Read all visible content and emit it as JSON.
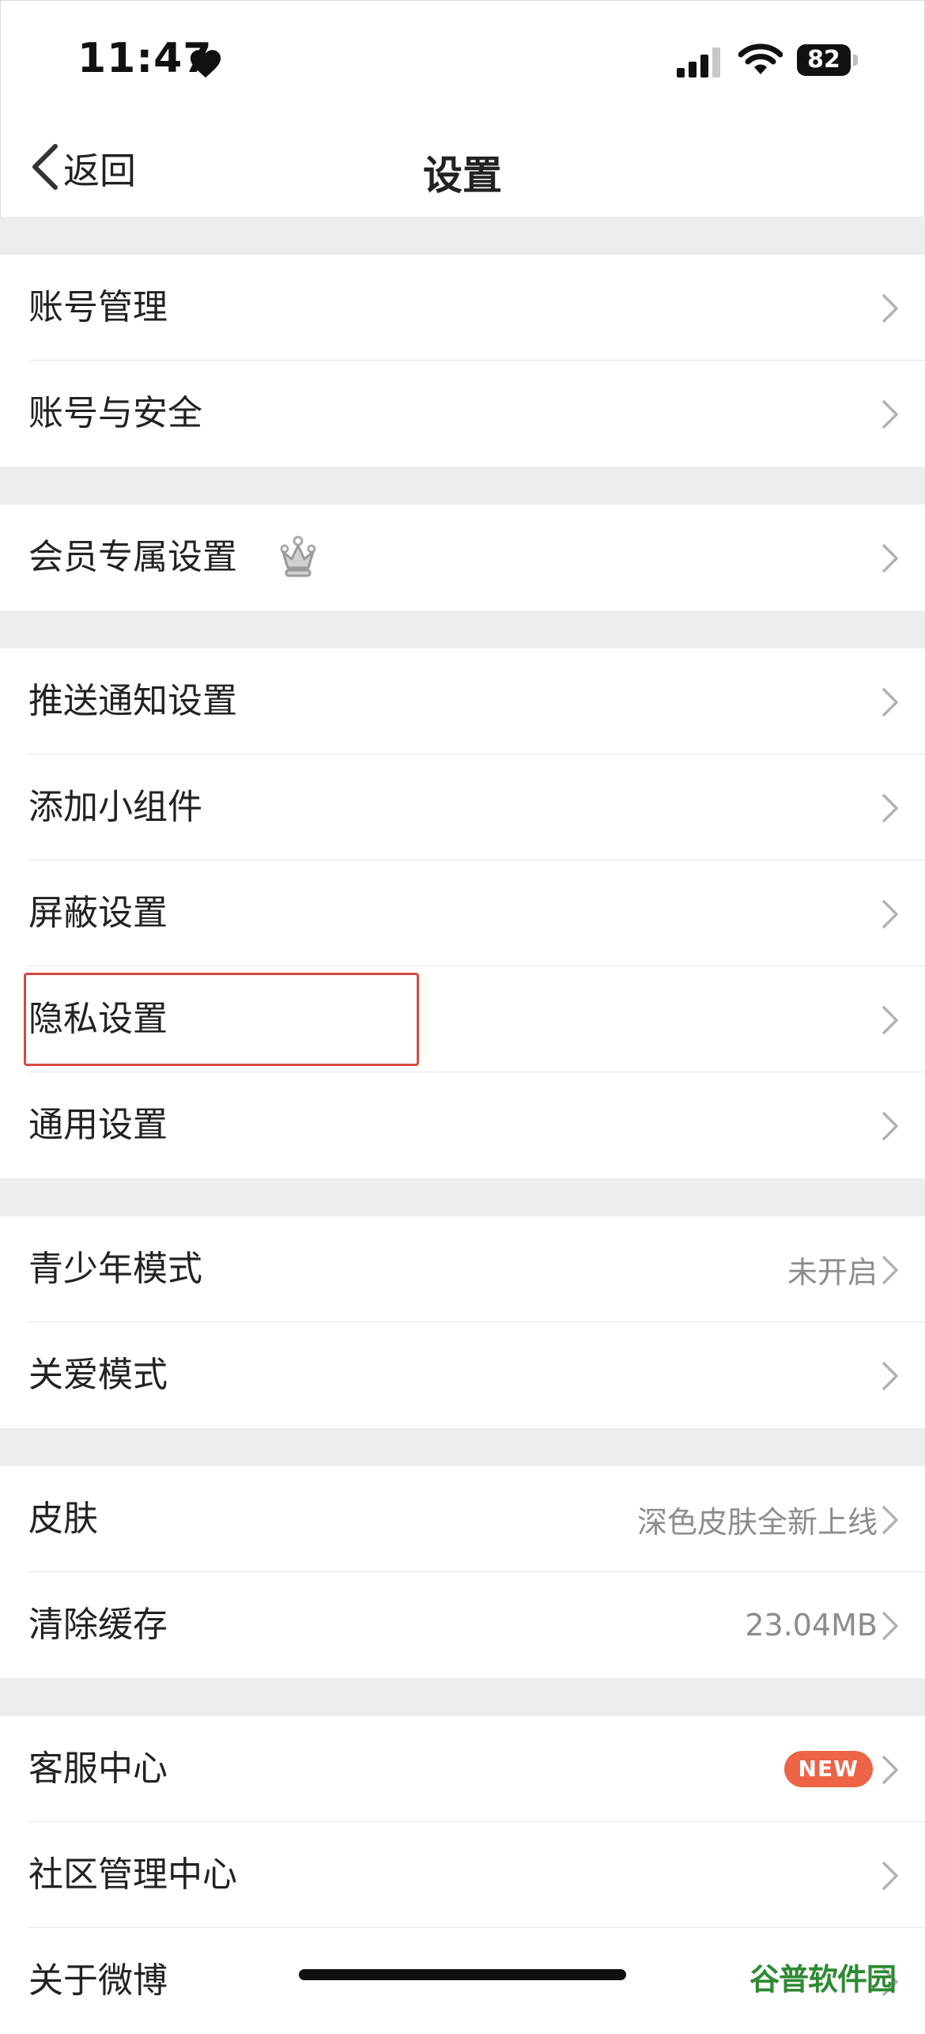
{
  "status_bar": {
    "time": "11:47",
    "battery": "82"
  },
  "nav": {
    "back_label": "返回",
    "title": "设置"
  },
  "sections": [
    {
      "rows": [
        {
          "label": "账号管理"
        },
        {
          "label": "账号与安全"
        }
      ]
    },
    {
      "rows": [
        {
          "label": "会员专属设置",
          "icon": "crown-icon"
        }
      ]
    },
    {
      "rows": [
        {
          "label": "推送通知设置"
        },
        {
          "label": "添加小组件"
        },
        {
          "label": "屏蔽设置"
        },
        {
          "label": "隐私设置",
          "highlighted": true
        },
        {
          "label": "通用设置"
        }
      ]
    },
    {
      "rows": [
        {
          "label": "青少年模式",
          "value": "未开启"
        },
        {
          "label": "关爱模式"
        }
      ]
    },
    {
      "rows": [
        {
          "label": "皮肤",
          "value": "深色皮肤全新上线"
        },
        {
          "label": "清除缓存",
          "value": "23.04MB"
        }
      ]
    },
    {
      "rows": [
        {
          "label": "客服中心",
          "badge": "NEW"
        },
        {
          "label": "社区管理中心"
        },
        {
          "label": "关于微博"
        }
      ]
    }
  ],
  "watermark": "谷普软件园",
  "colors": {
    "section_gap": "#ededed",
    "badge": "#ee6446",
    "highlight_box": "#d44a43",
    "value_text": "#8c8c8c"
  }
}
